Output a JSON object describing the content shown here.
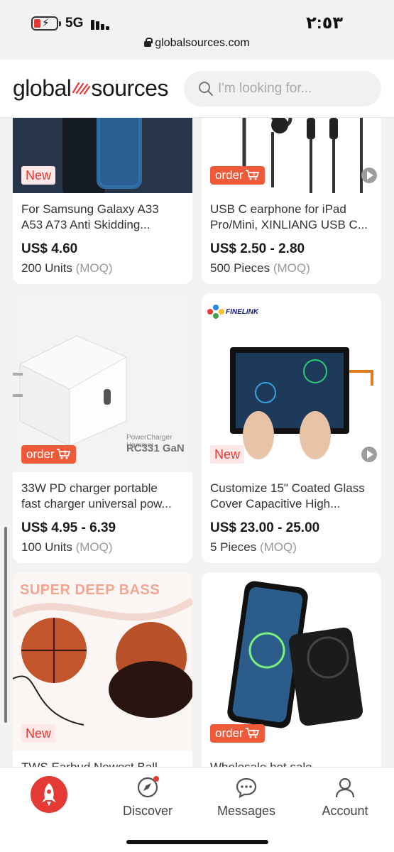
{
  "status_bar": {
    "network": "5G",
    "time": "٢:٥٣"
  },
  "url_bar": {
    "domain": "globalsources.com"
  },
  "header": {
    "logo_left": "global",
    "logo_right": "sources",
    "search_placeholder": "I'm looking for..."
  },
  "products": [
    {
      "badge": "New",
      "title_line1": "For Samsung Galaxy A33",
      "title_line2": "A53 A73 Anti Skidding...",
      "price": "US$ 4.60",
      "qty": "200 Units",
      "moq": "(MOQ)"
    },
    {
      "badge": "order",
      "title_line1": "USB C earphone for iPad",
      "title_line2": "Pro/Mini, XINLIANG USB C...",
      "price": "US$ 2.50 - 2.80",
      "qty": "500 Pieces",
      "moq": "(MOQ)"
    },
    {
      "badge": "order",
      "image_text_1": "PowerCharger Hammer",
      "image_text_2": "RC331 GaN",
      "title_line1": "33W PD charger portable",
      "title_line2": "fast charger universal pow...",
      "price": "US$ 4.95 - 6.39",
      "qty": "100 Units",
      "moq": "(MOQ)"
    },
    {
      "badge": "New",
      "image_brand": "FINELINK",
      "title_line1": "Customize 15\" Coated Glass",
      "title_line2": "Cover Capacitive High...",
      "price": "US$ 23.00 - 25.00",
      "qty": "5 Pieces",
      "moq": "(MOQ)"
    },
    {
      "badge": "New",
      "image_text": "SUPER DEEP BASS",
      "title_line1": "TWS Earbud Newest Ball"
    },
    {
      "badge": "order",
      "title_line1": "Wholesale hot sale"
    }
  ],
  "bottom_nav": {
    "discover": "Discover",
    "messages": "Messages",
    "account": "Account"
  },
  "colors": {
    "brand_red": "#e53935",
    "order_orange": "#ef5a3a"
  }
}
